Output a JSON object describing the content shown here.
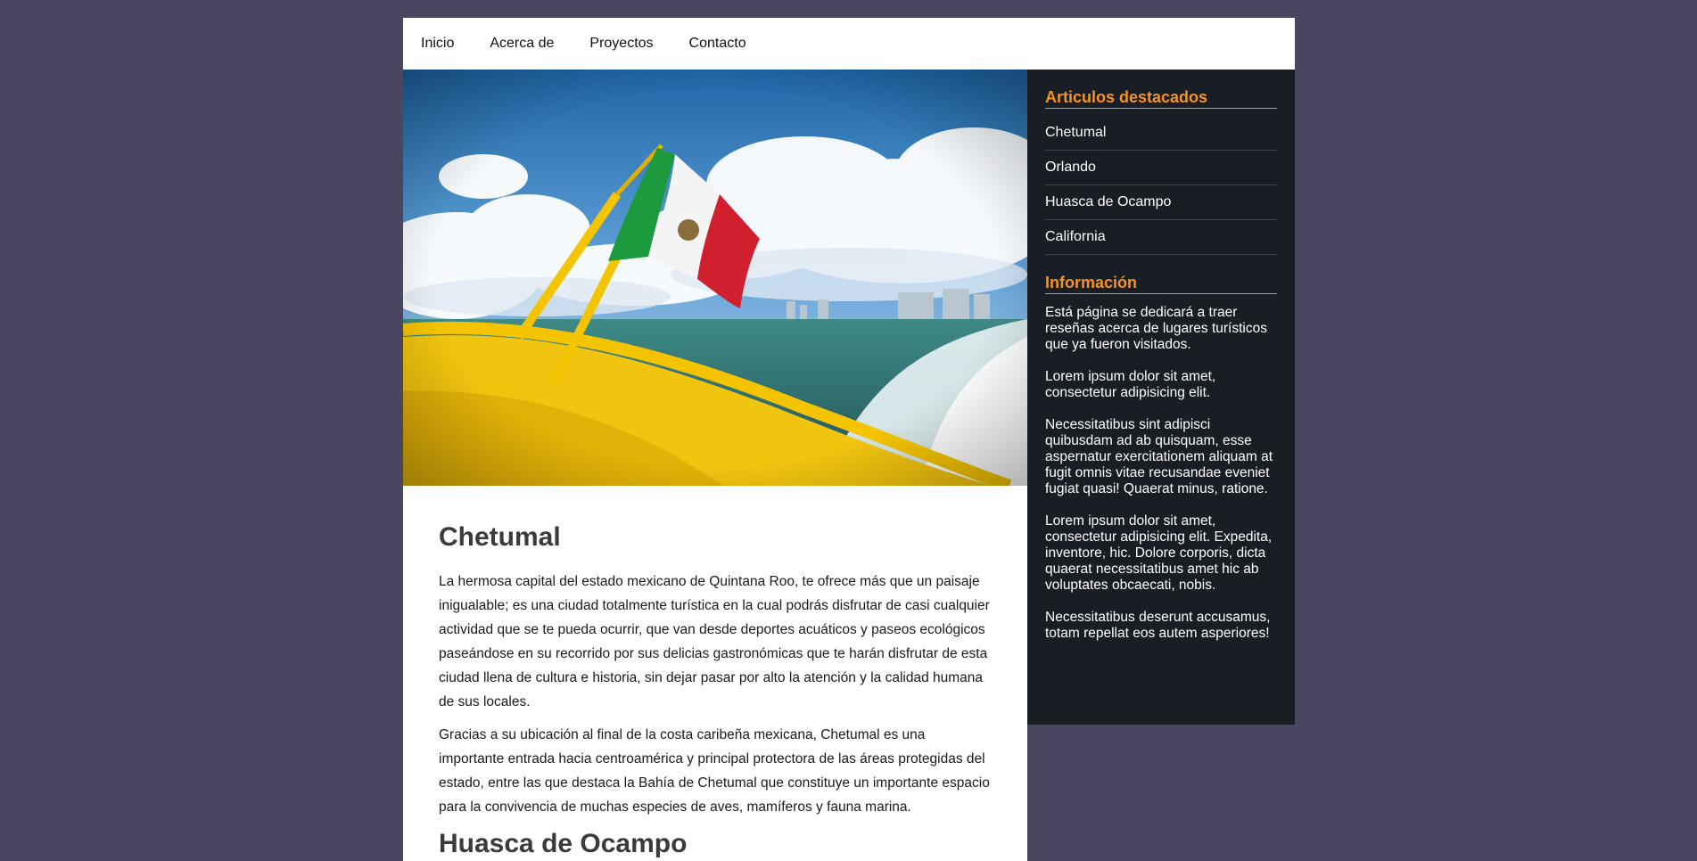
{
  "nav": {
    "items": [
      {
        "label": "Inicio"
      },
      {
        "label": "Acerca de"
      },
      {
        "label": "Proyectos"
      },
      {
        "label": "Contacto"
      }
    ]
  },
  "hero": {
    "image_name": "boat-mexican-flag-photo"
  },
  "main": {
    "title": "Chetumal",
    "paragraphs": [
      "La hermosa capital del estado mexicano de Quintana Roo, te ofrece más que un paisaje inigualable; es una ciudad totalmente turística en la cual podrás disfrutar de casi cualquier actividad que se te pueda ocurrir, que van desde deportes acuáticos y paseos ecológicos paseándose en su recorrido por sus delicias gastronómicas que te harán disfrutar de esta ciudad llena de cultura e historia, sin dejar pasar por alto la atención y la calidad humana de sus locales.",
      "Gracias a su ubicación al final de la costa caribeña mexicana, Chetumal es una importante entrada hacia centroamérica y principal protectora de las áreas protegidas del estado, entre las que destaca la Bahía de Chetumal que constituye un importante espacio para la convivencia de muchas especies de aves, mamíferos y fauna marina."
    ],
    "next_title": "Huasca de Ocampo"
  },
  "sidebar": {
    "featured_title": "Articulos destacados",
    "featured_items": [
      {
        "label": "Chetumal"
      },
      {
        "label": "Orlando"
      },
      {
        "label": "Huasca de Ocampo"
      },
      {
        "label": "California"
      }
    ],
    "info_title": "Información",
    "info_paragraphs": [
      "Está página se dedicará a traer reseñas acerca de lugares turísticos que ya fueron visitados.",
      "Lorem ipsum dolor sit amet, consectetur adipisicing elit.",
      "Necessitatibus sint adipisci quibusdam ad ab quisquam, esse aspernatur exercitationem aliquam at fugit omnis vitae recusandae eveniet fugiat quasi! Quaerat minus, ratione.",
      "Lorem ipsum dolor sit amet, consectetur adipisicing elit. Expedita, inventore, hic. Dolore corporis, dicta quaerat necessitatibus amet hic ab voluptates obcaecati, nobis.",
      "Necessitatibus deserunt accusamus, totam repellat eos autem asperiores!"
    ]
  },
  "colors": {
    "background": "#4a4660",
    "sidebar_bg": "#181e24",
    "accent": "#f7931e"
  }
}
